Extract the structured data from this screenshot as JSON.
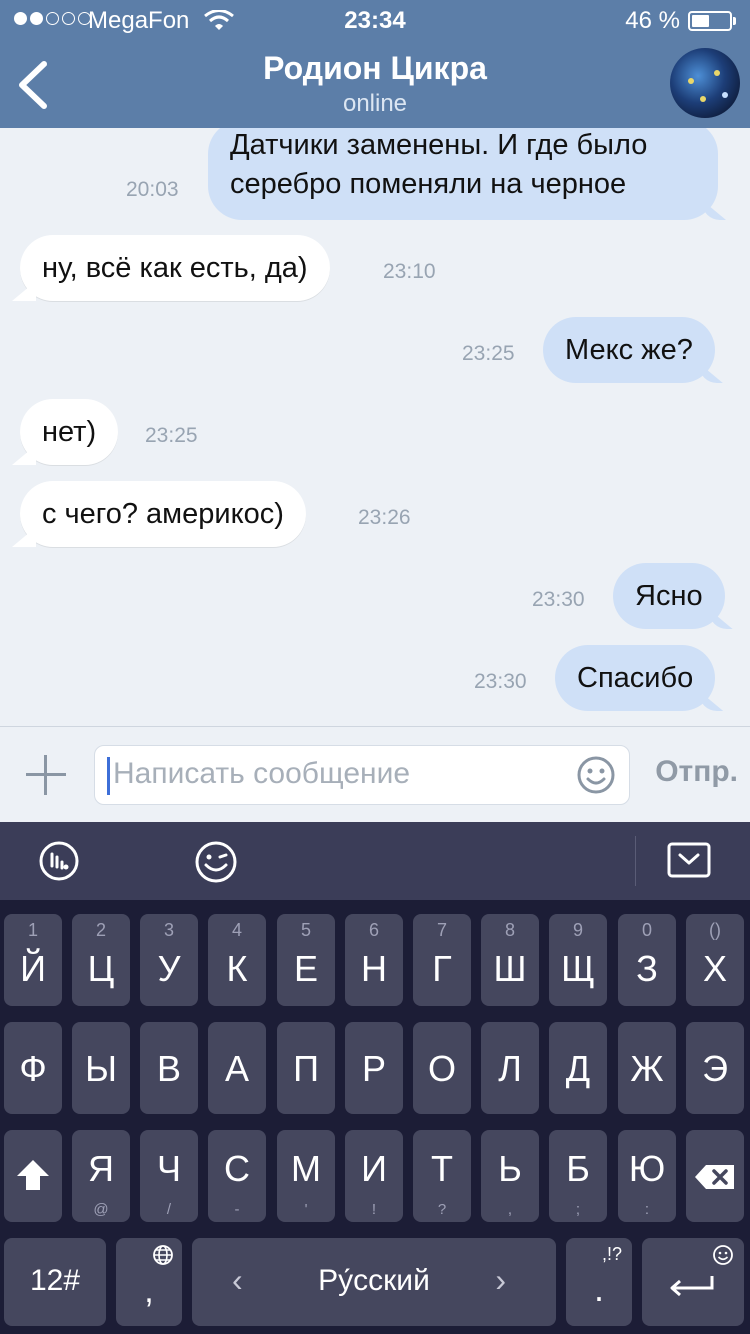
{
  "status_bar": {
    "carrier": "MegaFon",
    "time": "23:34",
    "battery_percent": "46 %",
    "battery_level": 0.46,
    "signal_dots": [
      true,
      true,
      false,
      false,
      false
    ]
  },
  "header": {
    "contact_name": "Родион Цикра",
    "contact_status": "online"
  },
  "messages": [
    {
      "direction": "out",
      "lines": [
        "Датчики заменены. И где было",
        "серебро поменяли на черное"
      ],
      "time": "20:03"
    },
    {
      "direction": "in",
      "text": "ну, всё как есть, да)",
      "time": "23:10"
    },
    {
      "direction": "out",
      "text": "Мекс же?",
      "time": "23:25"
    },
    {
      "direction": "in",
      "text": "нет)",
      "time": "23:25"
    },
    {
      "direction": "in",
      "text": "с чего? америкос)",
      "time": "23:26"
    },
    {
      "direction": "out",
      "text": "Ясно",
      "time": "23:30"
    },
    {
      "direction": "out",
      "text": "Спасибо",
      "time": "23:30"
    }
  ],
  "composer": {
    "placeholder": "Написать сообщение",
    "send_label": "Отпр."
  },
  "keyboard": {
    "row1": [
      {
        "hint": "1",
        "label": "Й"
      },
      {
        "hint": "2",
        "label": "Ц"
      },
      {
        "hint": "3",
        "label": "У"
      },
      {
        "hint": "4",
        "label": "К"
      },
      {
        "hint": "5",
        "label": "Е"
      },
      {
        "hint": "6",
        "label": "Н"
      },
      {
        "hint": "7",
        "label": "Г"
      },
      {
        "hint": "8",
        "label": "Ш"
      },
      {
        "hint": "9",
        "label": "Щ"
      },
      {
        "hint": "0",
        "label": "З"
      },
      {
        "hint": "()",
        "label": "Х"
      }
    ],
    "row2": [
      "Ф",
      "Ы",
      "В",
      "А",
      "П",
      "Р",
      "О",
      "Л",
      "Д",
      "Ж",
      "Э"
    ],
    "row3": [
      {
        "label": "Я",
        "sub": "@"
      },
      {
        "label": "Ч",
        "sub": "/"
      },
      {
        "label": "С",
        "sub": "-"
      },
      {
        "label": "М",
        "sub": "'"
      },
      {
        "label": "И",
        "sub": "!"
      },
      {
        "label": "Т",
        "sub": "?"
      },
      {
        "label": "Ь",
        "sub": ","
      },
      {
        "label": "Б",
        "sub": ";"
      },
      {
        "label": "Ю",
        "sub": ":"
      }
    ],
    "numbers_label": "12#",
    "comma_label": ",",
    "space_label": "Ру́сский",
    "space_left_arrow": "‹",
    "space_right_arrow": "›",
    "punct_hint": ",!?",
    "period_label": "."
  }
}
